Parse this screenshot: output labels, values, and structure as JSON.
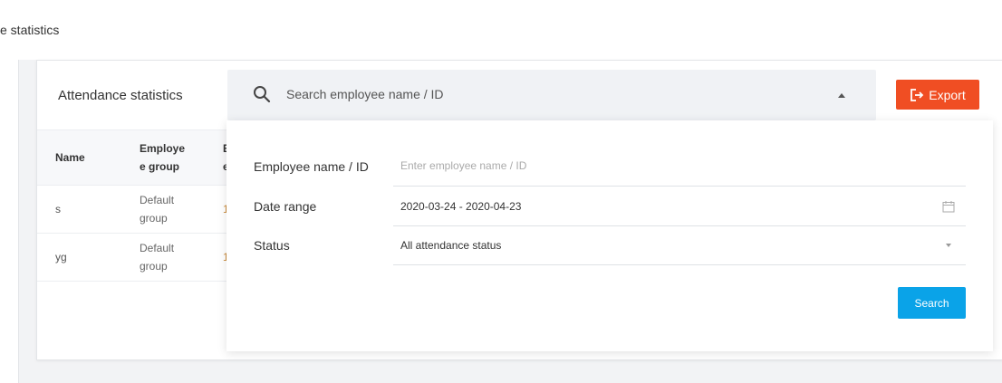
{
  "breadcrumb": "e statistics",
  "card": {
    "title": "Attendance statistics",
    "search_placeholder": "Search employee name / ID",
    "export_label": "Export"
  },
  "table": {
    "headers": {
      "name": "Name",
      "group_line1": "Employe",
      "group_line2": "e group",
      "extra_line1": "E",
      "extra_line2": "e"
    },
    "rows": [
      {
        "name": "s",
        "group_line1": "Default",
        "group_line2": "group",
        "extra": "1"
      },
      {
        "name": "yg",
        "group_line1": "Default",
        "group_line2": "group",
        "extra": "1"
      }
    ]
  },
  "filter": {
    "employee_label": "Employee name / ID",
    "employee_placeholder": "Enter employee name / ID",
    "date_label": "Date range",
    "date_value": "2020-03-24 - 2020-04-23",
    "status_label": "Status",
    "status_value": "All attendance status",
    "search_button": "Search"
  },
  "colors": {
    "export_bg": "#f04e23",
    "search_btn_bg": "#0aa3e8",
    "page_bg": "#f2f3f5"
  },
  "icons": {
    "search": "search-icon",
    "caret_up": "caret-up-icon",
    "export": "export-icon",
    "calendar": "calendar-icon",
    "caret_down": "chevron-down-icon"
  }
}
